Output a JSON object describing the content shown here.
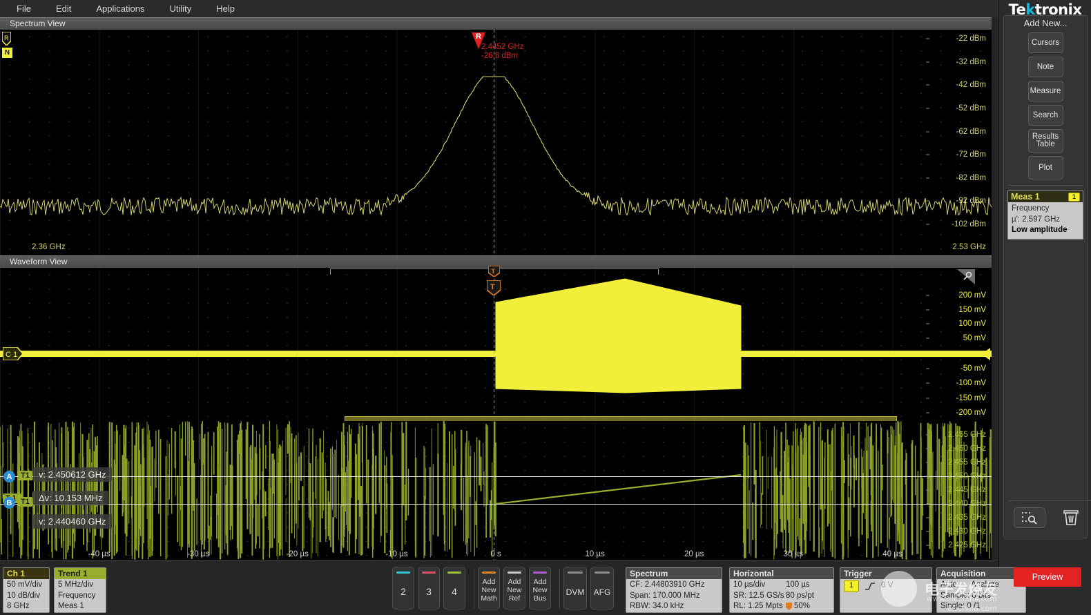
{
  "menubar": {
    "items": [
      "File",
      "Edit",
      "Applications",
      "Utility",
      "Help"
    ]
  },
  "views": {
    "spectrum": {
      "title": "Spectrum View"
    },
    "waveform": {
      "title": "Waveform View"
    }
  },
  "spectrum": {
    "y_labels": [
      "-22 dBm",
      "-32 dBm",
      "-42 dBm",
      "-52 dBm",
      "-62 dBm",
      "-72 dBm",
      "-82 dBm",
      "-92 dBm",
      "-102 dBm"
    ],
    "x_start": "2.36 GHz",
    "x_end": "2.53 GHz",
    "marker": {
      "label": "R",
      "freq": "2.4452 GHz",
      "ampl": "-26.8 dBm"
    },
    "left_markers": {
      "ref": "R",
      "noise": "N"
    }
  },
  "waveform": {
    "y_labels": [
      "200 mV",
      "150 mV",
      "100 mV",
      "50 mV",
      "-50 mV",
      "-100 mV",
      "-150 mV",
      "-200 mV"
    ],
    "channel_badge": "C 1",
    "trigger_marker": "T"
  },
  "trend": {
    "y_labels": [
      "2.465 GHz",
      "2.460 GHz",
      "2.455 GHz",
      "2.450 GHz",
      "2.445 GHz",
      "2.440 GHz",
      "2.435 GHz",
      "2.430 GHz",
      "2.425 GHz"
    ],
    "x_labels": [
      "-40 µs",
      "-30 µs",
      "-20 µs",
      "-10 µs",
      "0 s",
      "10 µs",
      "20 µs",
      "30 µs",
      "40 µs"
    ],
    "cursors": {
      "a_label": "A",
      "a_tag": "T1",
      "a_value": "v: 2.450612 GHz",
      "delta_tag": "T 1",
      "delta_value": "Δv: 10.153 MHz",
      "b_label": "B",
      "b_tag": "T1",
      "b_value": "v: 2.440460 GHz"
    }
  },
  "sidebar": {
    "brand_pre": "Te",
    "brand_k": "k",
    "brand_post": "tronix",
    "add_new_title": "Add New...",
    "buttons": [
      "Cursors",
      "Note",
      "Measure",
      "Search",
      "Results Table",
      "Plot"
    ],
    "meas": {
      "title": "Meas 1",
      "chip": "1",
      "type": "Frequency",
      "value": "µ': 2.597 GHz",
      "status": "Low amplitude"
    },
    "tools": {
      "zoom_icon": "search-area-icon",
      "delete_icon": "trash-icon"
    }
  },
  "bottom": {
    "ch1": {
      "title": "Ch 1",
      "lines": [
        "50 mV/div",
        "10 dB/div",
        "8 GHz"
      ]
    },
    "trend1": {
      "title": "Trend 1",
      "lines": [
        "5 MHz/div",
        "Frequency",
        "Meas 1"
      ]
    },
    "channels": [
      {
        "label": "2",
        "color": "#2ec6d6"
      },
      {
        "label": "3",
        "color": "#e0506b"
      },
      {
        "label": "4",
        "color": "#9dc63f"
      }
    ],
    "adds": [
      {
        "label": "Add New Math",
        "color": "#e08a2a"
      },
      {
        "label": "Add New Ref",
        "color": "#cccccc"
      },
      {
        "label": "Add New Bus",
        "color": "#b45cd6"
      }
    ],
    "misc": [
      {
        "label": "DVM",
        "color": "#8d8d8d"
      },
      {
        "label": "AFG",
        "color": "#8d8d8d"
      }
    ],
    "spectrum_badge": {
      "title": "Spectrum",
      "lines": [
        "CF: 2.44803910 GHz",
        "Span: 170.000 MHz",
        "RBW: 34.0 kHz"
      ]
    },
    "horizontal_badge": {
      "title": "Horizontal",
      "rows": [
        [
          "10 µs/div",
          "100 µs"
        ],
        [
          "SR: 12.5 GS/s",
          "80 ps/pt"
        ],
        [
          "RL: 1.25 Mpts",
          "50%"
        ]
      ]
    },
    "trigger_badge": {
      "title": "Trigger",
      "chip": "1",
      "slope": "rising-edge-icon",
      "level": "0 V"
    },
    "acquisition_badge": {
      "title": "Acquisition",
      "rows": [
        [
          "Auto,",
          "Analyze"
        ],
        [
          "Sample: 8 bits",
          ""
        ],
        [
          "Single: 0 /1",
          ""
        ]
      ]
    },
    "preview": "Preview"
  },
  "watermark": {
    "cn": "电子发烧友",
    "url1": "www.elecfans.com",
    "url2": "EEChina.com"
  },
  "colors": {
    "ch1_yellow": "#f2ef3a",
    "spectrum_trace": "#d6d46a",
    "trend_green": "#9aae2e",
    "marker_red": "#e02020",
    "trigger_orange": "#e07a1e",
    "brand_cyan": "#19b6d9",
    "preview_red": "#e32222"
  }
}
